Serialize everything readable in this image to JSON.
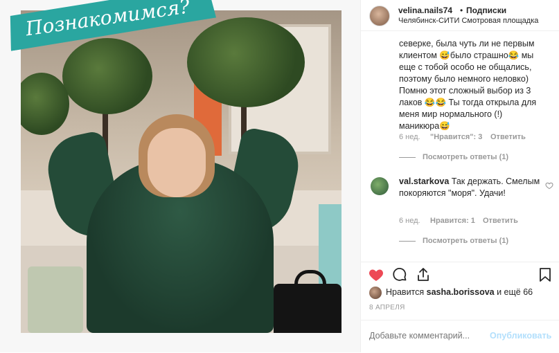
{
  "banner": {
    "text": "Познакомимся?"
  },
  "header": {
    "username": "velina.nails74",
    "separator": "•",
    "follow_label": "Подписки",
    "location": "Челябинск-СИТИ Смотровая площадка"
  },
  "comments": [
    {
      "text_lines": "северке, была чуть ли не первым клиентом 😅было страшно😂 мы еще с тобой особо не общались, поэтому было немного неловко) Помню этот сложный выбор из 3 лаков 😂😂 Ты тогда открыла для меня мир нормального (!) маникюра😅",
      "time": "6 нед.",
      "likes": "\"Нравится\": 3",
      "reply": "Ответить",
      "view_replies": "Посмотреть ответы (1)"
    },
    {
      "user": "val.starkova",
      "text": " Так держать. Смелым покоряются \"моря\". Удачи!",
      "time": "6 нед.",
      "likes": "Нравится: 1",
      "reply": "Ответить",
      "view_replies": "Посмотреть ответы (1)"
    }
  ],
  "likes_line": {
    "prefix": "Нравится ",
    "user": "sasha.borissova",
    "suffix": " и ещё 66"
  },
  "date": "8 АПРЕЛЯ",
  "add_comment": {
    "placeholder": "Добавьте комментарий...",
    "publish": "Опубликовать"
  },
  "colors": {
    "heart": "#ed4956",
    "banner": "#2aa6a0",
    "publish": "#b2dffc",
    "muted": "#999999"
  },
  "icons": [
    "heart-icon",
    "comment-icon",
    "share-icon",
    "bookmark-icon",
    "small-heart-icon"
  ]
}
